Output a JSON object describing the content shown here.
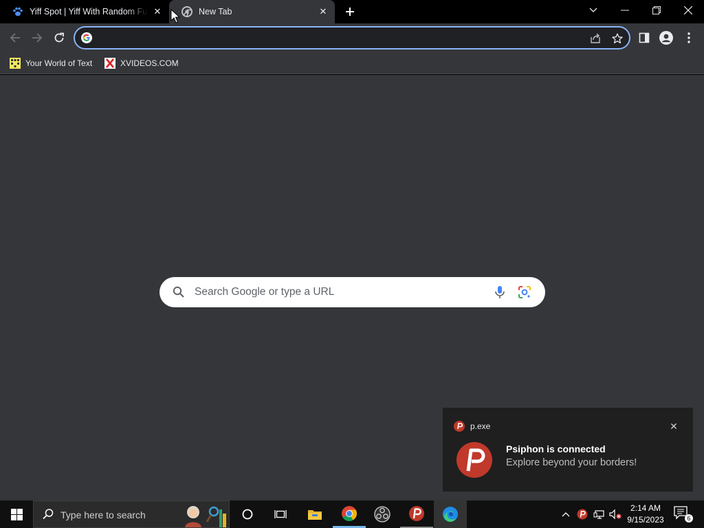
{
  "tabs": [
    {
      "title": "Yiff Spot | Yiff With Random Furries",
      "favicon": "paw-icon",
      "active": false
    },
    {
      "title": "New Tab",
      "favicon": "chrome-icon",
      "active": true
    }
  ],
  "omnibox": {
    "value": "",
    "placeholder": ""
  },
  "bookmarks": [
    {
      "label": "Your World of Text",
      "icon": "yourworldoftext-icon"
    },
    {
      "label": "XVIDEOS.COM",
      "icon": "x-icon"
    }
  ],
  "ntp": {
    "search_placeholder": "Search Google or type a URL"
  },
  "toast": {
    "app_name": "p.exe",
    "title": "Psiphon is connected",
    "body": "Explore beyond your borders!"
  },
  "taskbar": {
    "search_placeholder": "Type here to search",
    "time": "2:14 AM",
    "date": "9/15/2023",
    "notification_count": "6"
  },
  "colors": {
    "page_bg": "#35363a",
    "focus_ring": "#8ab4f8",
    "taskbar_bg": "#101010",
    "psiphon_red": "#c0392b"
  }
}
